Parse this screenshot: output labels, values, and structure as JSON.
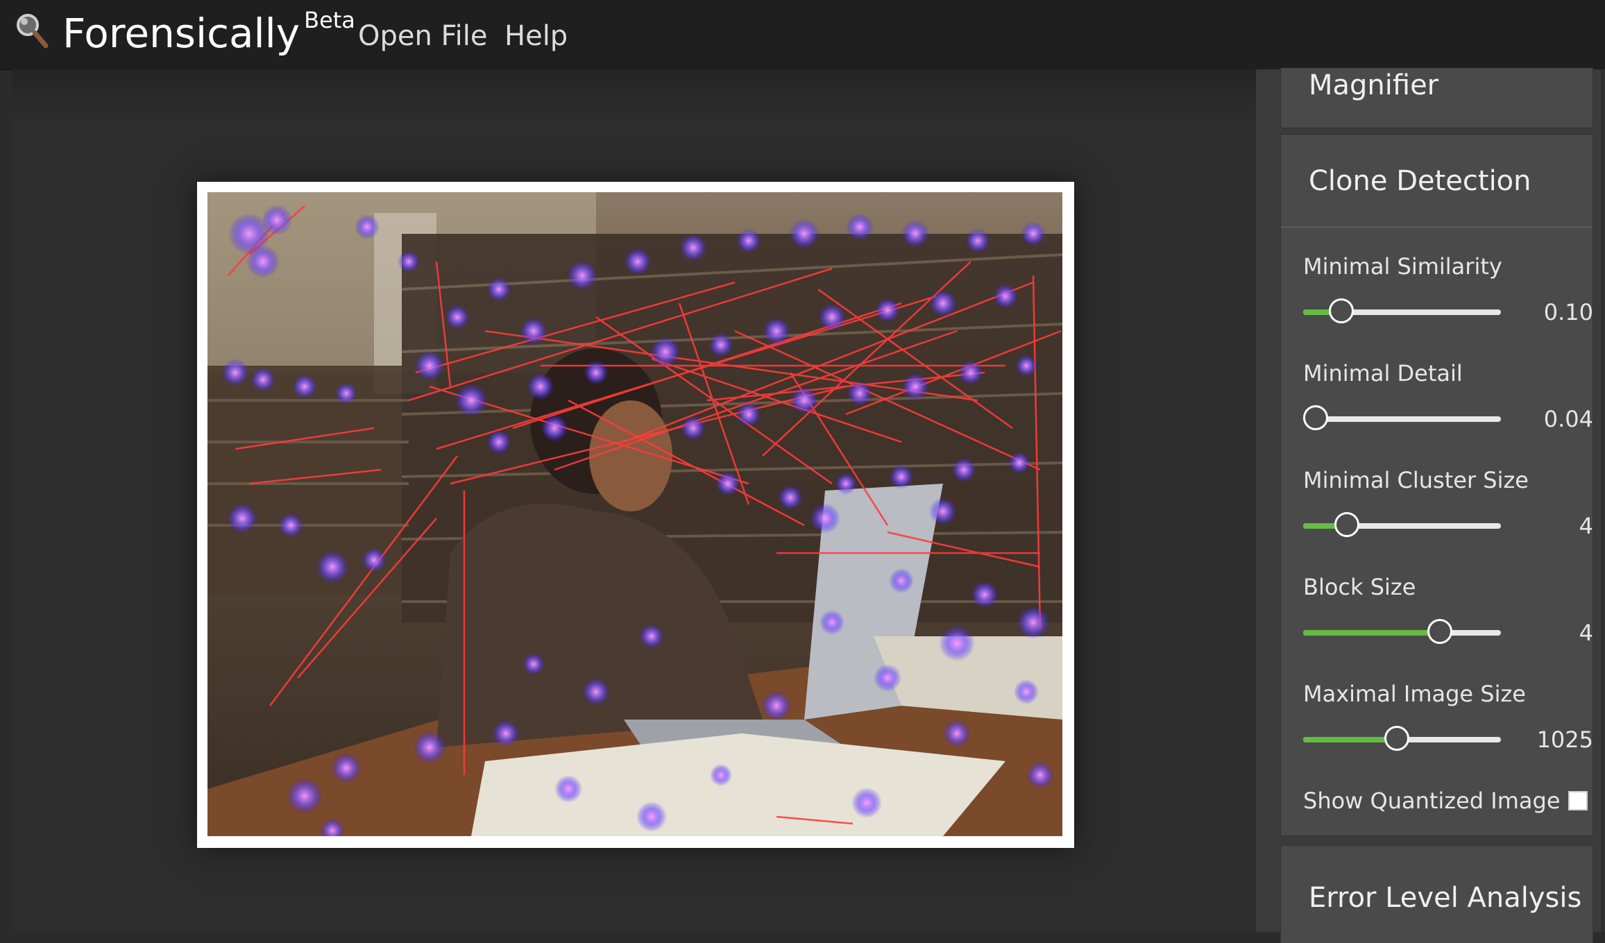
{
  "app": {
    "title": "Forensically",
    "badge": "Beta",
    "menu": [
      {
        "label": "Open File"
      },
      {
        "label": "Help"
      }
    ]
  },
  "sidebar": {
    "magnifier_title": "Magnifier",
    "clone_title": "Clone Detection",
    "ela_title": "Error Level Analysis",
    "params": [
      {
        "label": "Minimal Similarity",
        "value": "0.10",
        "fraction": 0.15
      },
      {
        "label": "Minimal Detail",
        "value": "0.04",
        "fraction": 0.0
      },
      {
        "label": "Minimal Cluster Size",
        "value": "4",
        "fraction": 0.18
      },
      {
        "label": "Block Size",
        "value": "4",
        "fraction": 0.72
      },
      {
        "label": "Maximal Image Size",
        "value": "1025",
        "fraction": 0.47
      }
    ],
    "show_quantized_label": "Show Quantized Image",
    "show_quantized_checked": false
  },
  "colors": {
    "slider_fill": "#66bb44",
    "match_line": "#ff3b3b",
    "match_blob": "#9966ff"
  },
  "icons": {
    "logo": "magnifier-icon"
  }
}
